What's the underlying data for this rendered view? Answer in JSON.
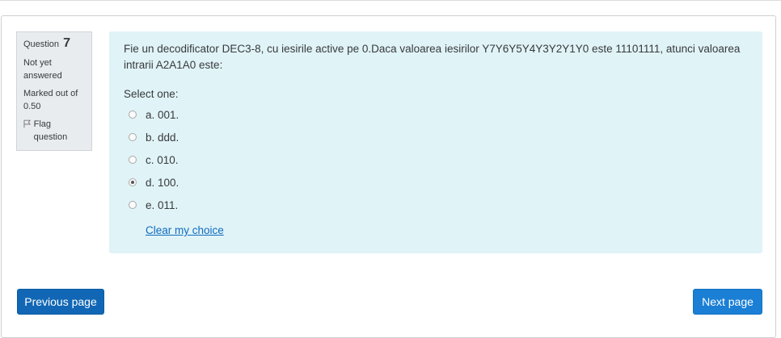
{
  "question": {
    "label": "Question",
    "number": "7",
    "state": "Not yet answered",
    "grade": "Marked out of 0.50",
    "flag": "Flag question",
    "text": "Fie un decodificator DEC3-8, cu iesirile active pe 0.Daca valoarea iesirilor Y7Y6Y5Y4Y3Y2Y1Y0 este 11101111, atunci valoarea intrarii A2A1A0 este:",
    "prompt": "Select one:",
    "options": [
      {
        "label": "a. 001.",
        "checked": false
      },
      {
        "label": "b. ddd.",
        "checked": false
      },
      {
        "label": "c. 010.",
        "checked": false
      },
      {
        "label": "d. 100.",
        "checked": true
      },
      {
        "label": "e. 011.",
        "checked": false
      }
    ],
    "clear": "Clear my choice"
  },
  "nav": {
    "previous": "Previous page",
    "next": "Next page"
  }
}
